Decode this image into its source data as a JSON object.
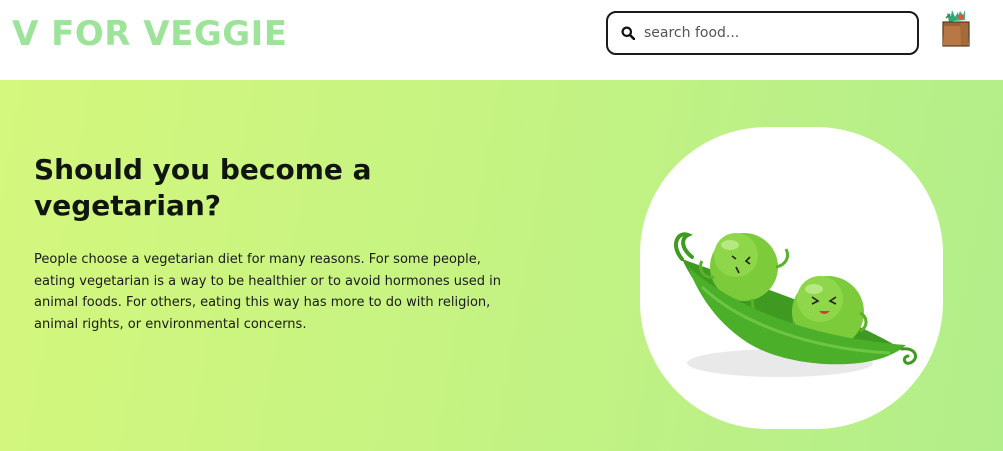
{
  "header": {
    "logo_text": "V FOR VEGGIE",
    "search": {
      "placeholder": "search food...",
      "value": ""
    },
    "icons": {
      "search": "search-icon",
      "bag": "grocery-bag-icon"
    }
  },
  "hero": {
    "title": "Should you become a vegetarian?",
    "description": "People choose a vegetarian diet for many reasons. For some people, eating vegetarian is a way to be healthier or to avoid hormones used in animal foods. For others, eating this way has more to do with religion, animal rights, or environmental concerns.",
    "image": "peas-in-a-pod-illustration"
  },
  "colors": {
    "logo": "#9ee39a",
    "hero_gradient_start": "#d4f77d",
    "hero_gradient_end": "#b2ee8a",
    "title_text": "#101510",
    "pea_green": "#6cc43a"
  }
}
